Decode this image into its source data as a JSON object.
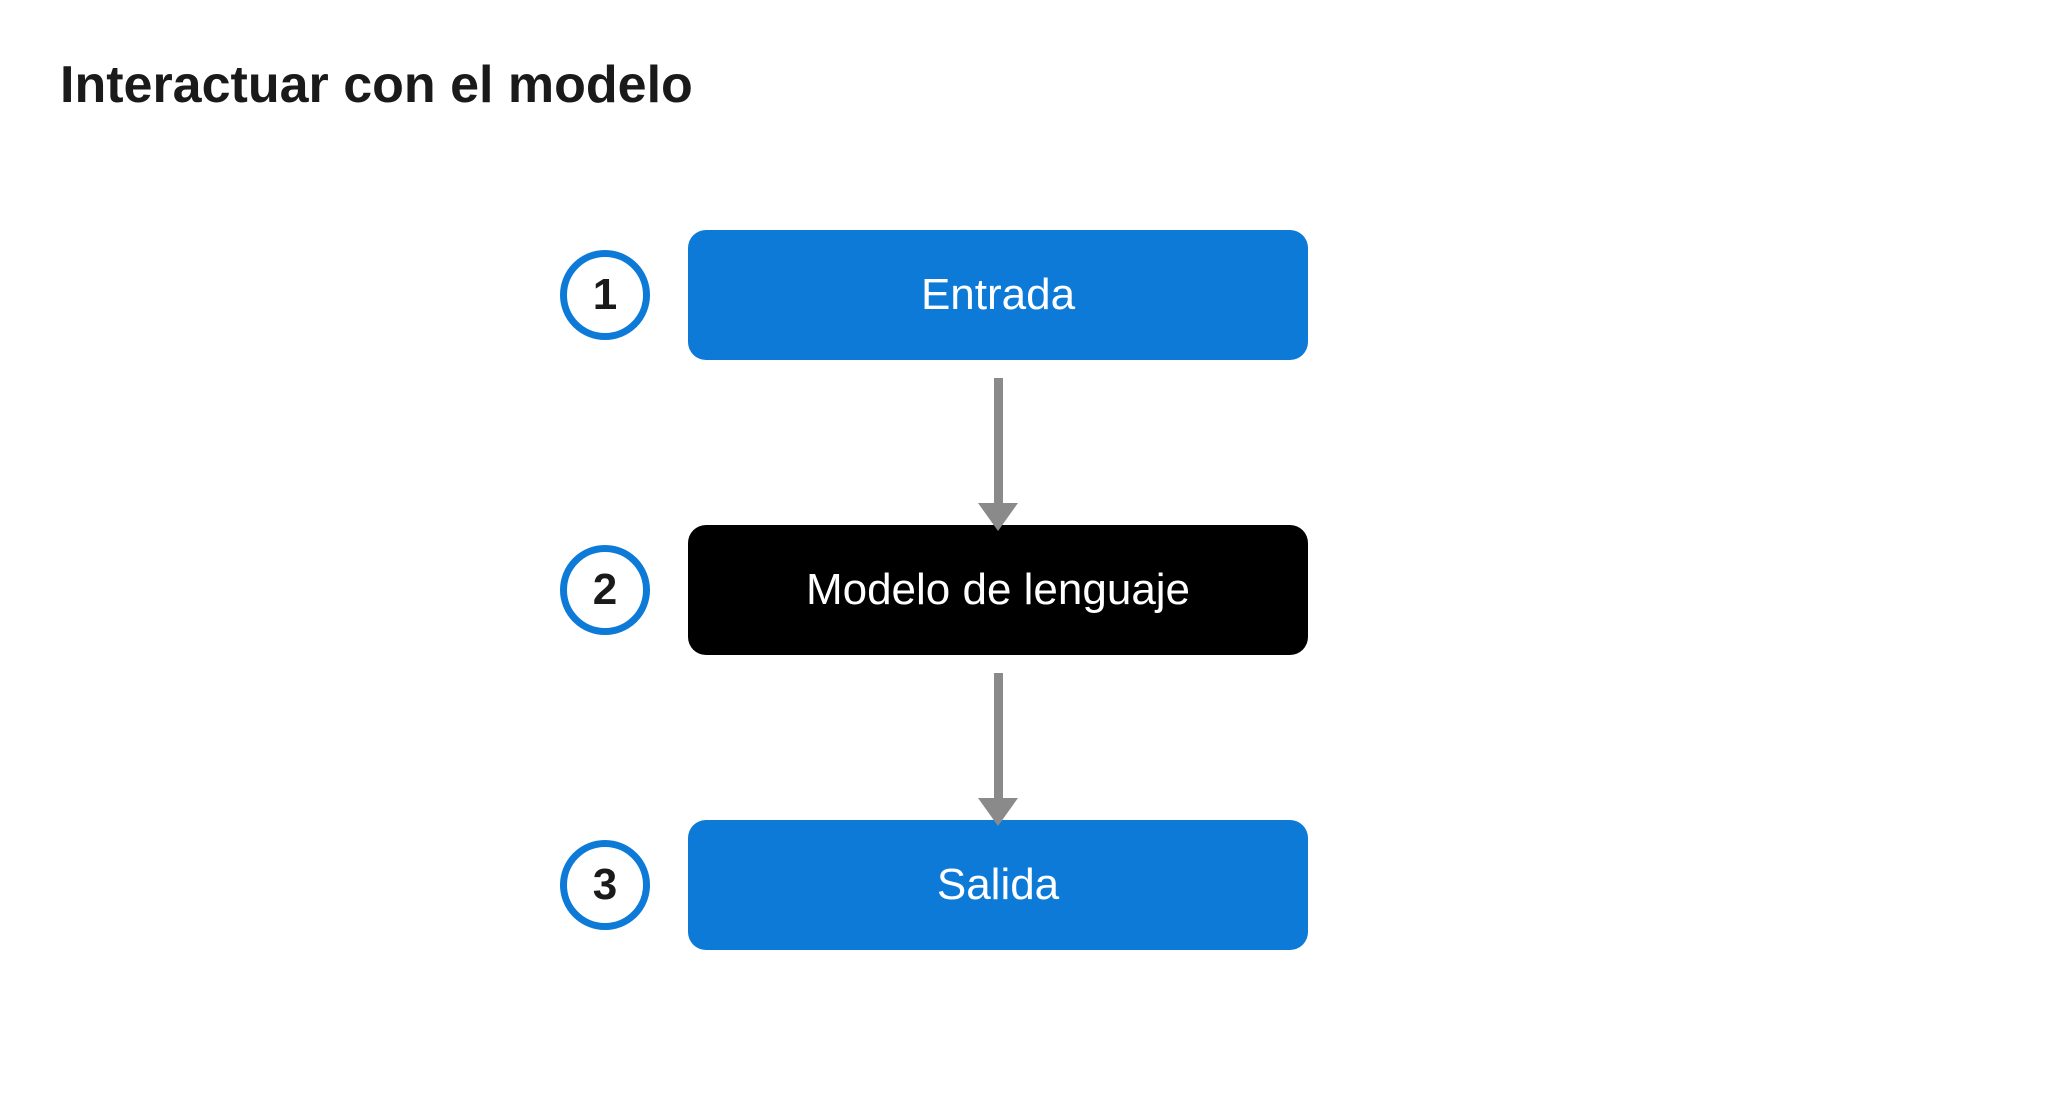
{
  "title": "Interactuar con el modelo",
  "steps": [
    {
      "number": "1",
      "label": "Entrada",
      "style": "blue"
    },
    {
      "number": "2",
      "label": "Modelo de lenguaje",
      "style": "black"
    },
    {
      "number": "3",
      "label": "Salida",
      "style": "blue"
    }
  ],
  "colors": {
    "accent": "#0d7ad8",
    "dark": "#000000",
    "arrow": "#8a8a8a"
  }
}
